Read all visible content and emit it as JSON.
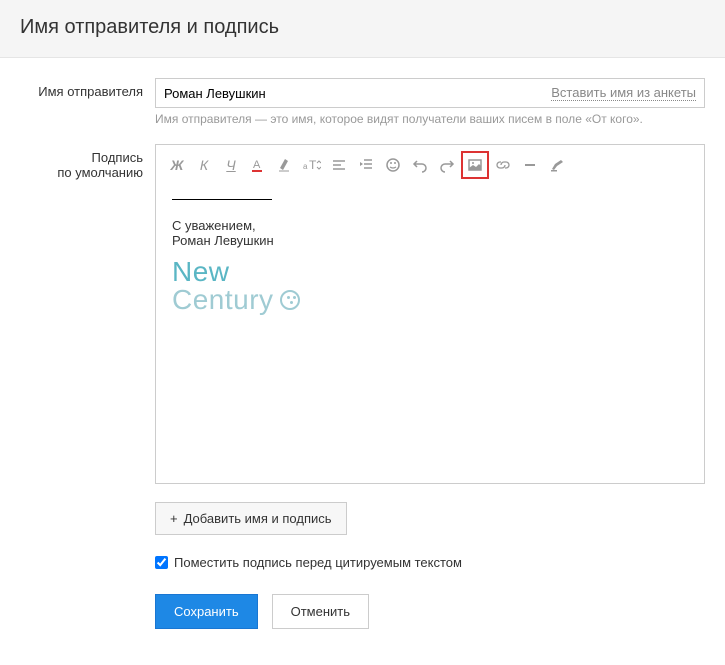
{
  "header": {
    "title": "Имя отправителя и подпись"
  },
  "sender": {
    "label": "Имя отправителя",
    "value": "Роман Левушкин",
    "insert_link": "Вставить имя из анкеты",
    "hint": "Имя отправителя — это имя, которое видят получатели ваших писем в поле «От кого»."
  },
  "signature": {
    "label_line1": "Подпись",
    "label_line2": "по умолчанию",
    "greeting": "С уважением,",
    "name": "Роман Левушкин",
    "logo_line1": "New",
    "logo_line2": "Century"
  },
  "toolbar": {
    "bold": "Ж",
    "italic": "К",
    "underline": "Ч"
  },
  "add_button": "Добавить имя и подпись",
  "checkbox": {
    "checked": true,
    "label": "Поместить подпись перед цитируемым текстом"
  },
  "actions": {
    "save": "Сохранить",
    "cancel": "Отменить"
  }
}
